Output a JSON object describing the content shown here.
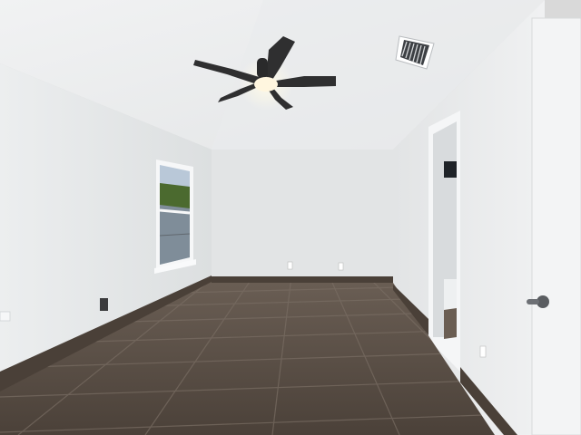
{
  "scene": {
    "kind": "photo",
    "subject": "empty-room",
    "colors": {
      "ceiling": "#eceeef",
      "left_wall": "#e6e7e8",
      "back_wall": "#e1e3e4",
      "right_wall": "#ebedee",
      "floor": "#574c43",
      "grout": "#7a6e64",
      "baseboard": "#4a4038",
      "fan_blade": "#2f2f30",
      "light": "#fff6df",
      "door_frame": "#f4f5f6",
      "window_sky": "#b9c8d8",
      "foliage": "#4b6a2f"
    },
    "icons": [
      "ceiling-fan-icon",
      "air-vent-icon",
      "door-knob-icon",
      "outlet-icon"
    ]
  }
}
